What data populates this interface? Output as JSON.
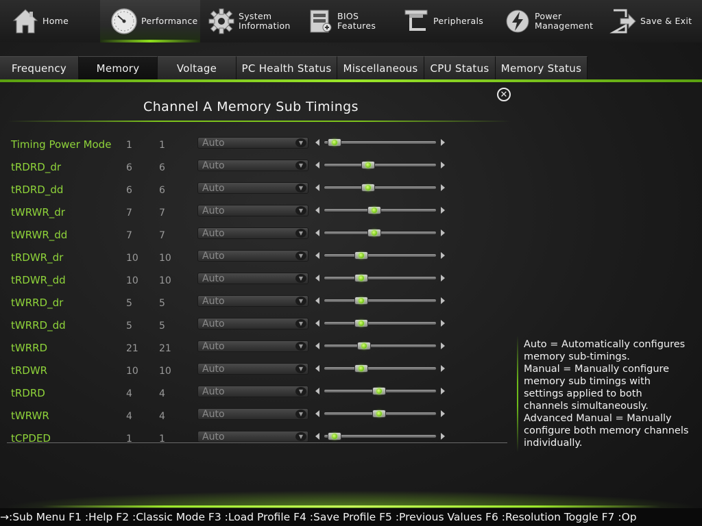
{
  "nav": [
    {
      "label": "Home",
      "icon": "home-icon",
      "active": false
    },
    {
      "label": "Performance",
      "icon": "speedometer-icon",
      "active": true
    },
    {
      "label": "System\nInformation",
      "icon": "gear-icon",
      "active": false
    },
    {
      "label": "BIOS\nFeatures",
      "icon": "chip-icon",
      "active": false
    },
    {
      "label": "Peripherals",
      "icon": "peripherals-icon",
      "active": false
    },
    {
      "label": "Power\nManagement",
      "icon": "power-icon",
      "active": false
    },
    {
      "label": "Save & Exit",
      "icon": "exit-icon",
      "active": false
    }
  ],
  "tabs": [
    {
      "label": "Frequency",
      "active": false
    },
    {
      "label": "Memory",
      "active": true
    },
    {
      "label": "Voltage",
      "active": false
    },
    {
      "label": "PC Health Status",
      "active": false
    },
    {
      "label": "Miscellaneous",
      "active": false
    },
    {
      "label": "CPU Status",
      "active": false
    },
    {
      "label": "Memory Status",
      "active": false
    }
  ],
  "panel": {
    "title": "Channel A Memory Sub Timings",
    "rows": [
      {
        "label": "Timing Power Mode",
        "v1": "1",
        "v2": "1",
        "setting": "Auto",
        "level": 0.04
      },
      {
        "label": "tRDRD_dr",
        "v1": "6",
        "v2": "6",
        "setting": "Auto",
        "level": 0.38
      },
      {
        "label": "tRDRD_dd",
        "v1": "6",
        "v2": "6",
        "setting": "Auto",
        "level": 0.38
      },
      {
        "label": "tWRWR_dr",
        "v1": "7",
        "v2": "7",
        "setting": "Auto",
        "level": 0.44
      },
      {
        "label": "tWRWR_dd",
        "v1": "7",
        "v2": "7",
        "setting": "Auto",
        "level": 0.44
      },
      {
        "label": "tRDWR_dr",
        "v1": "10",
        "v2": "10",
        "setting": "Auto",
        "level": 0.31
      },
      {
        "label": "tRDWR_dd",
        "v1": "10",
        "v2": "10",
        "setting": "Auto",
        "level": 0.31
      },
      {
        "label": "tWRRD_dr",
        "v1": "5",
        "v2": "5",
        "setting": "Auto",
        "level": 0.31
      },
      {
        "label": "tWRRD_dd",
        "v1": "5",
        "v2": "5",
        "setting": "Auto",
        "level": 0.31
      },
      {
        "label": "tWRRD",
        "v1": "21",
        "v2": "21",
        "setting": "Auto",
        "level": 0.34
      },
      {
        "label": "tRDWR",
        "v1": "10",
        "v2": "10",
        "setting": "Auto",
        "level": 0.31
      },
      {
        "label": "tRDRD",
        "v1": "4",
        "v2": "4",
        "setting": "Auto",
        "level": 0.49
      },
      {
        "label": "tWRWR",
        "v1": "4",
        "v2": "4",
        "setting": "Auto",
        "level": 0.49
      },
      {
        "label": "tCPDED",
        "v1": "1",
        "v2": "1",
        "setting": "Auto",
        "level": 0.04
      }
    ]
  },
  "help": {
    "text": "Auto = Automatically configures\nmemory sub-timings.\nManual = Manually configure\nmemory sub timings with\nsettings applied to both\nchannels simultaneously.\nAdvanced Manual = Manually\nconfigure both memory channels\nindividually."
  },
  "footer": {
    "text": "→:Sub Menu F1 :Help F2 :Classic Mode F3 :Load Profile F4 :Save Profile F5 :Previous Values F6 :Resolution Toggle F7 :Op"
  },
  "colors": {
    "accent": "#8ee01c",
    "label_green": "#8fd43a"
  }
}
